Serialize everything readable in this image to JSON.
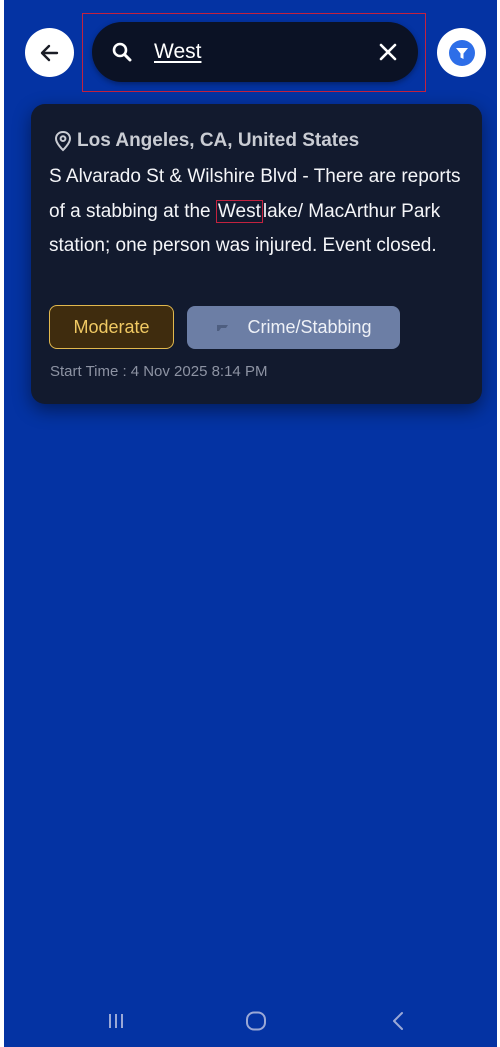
{
  "search": {
    "value": "West",
    "placeholder": ""
  },
  "incident": {
    "location": "Los Angeles, CA, United States",
    "description": {
      "before_match": "S Alvarado St & Wilshire Blvd - There are reports of a stabbing at the ",
      "match": "West",
      "after_match": "lake/ MacArthur Park station; one person was injured. Event closed."
    },
    "severity": "Moderate",
    "category": "Crime/Stabbing",
    "start_time_label": "Start Time :",
    "start_time_value": "4 Nov 2025 8:14 PM"
  },
  "colors": {
    "background": "#0433a3",
    "card": "#121a2e",
    "search_bar": "#0b1225",
    "severity_moderate": "#f0c963",
    "category_chip": "#6c7ea5",
    "highlight_outline": "#c3223f"
  },
  "icons": {
    "back": "arrow-left-icon",
    "search": "magnifier-icon",
    "clear": "close-icon",
    "filter": "funnel-icon",
    "location": "map-pin-icon",
    "category": "knife-icon",
    "nav_recents": "recent-apps-icon",
    "nav_home": "home-icon",
    "nav_back": "back-chevron-icon"
  }
}
